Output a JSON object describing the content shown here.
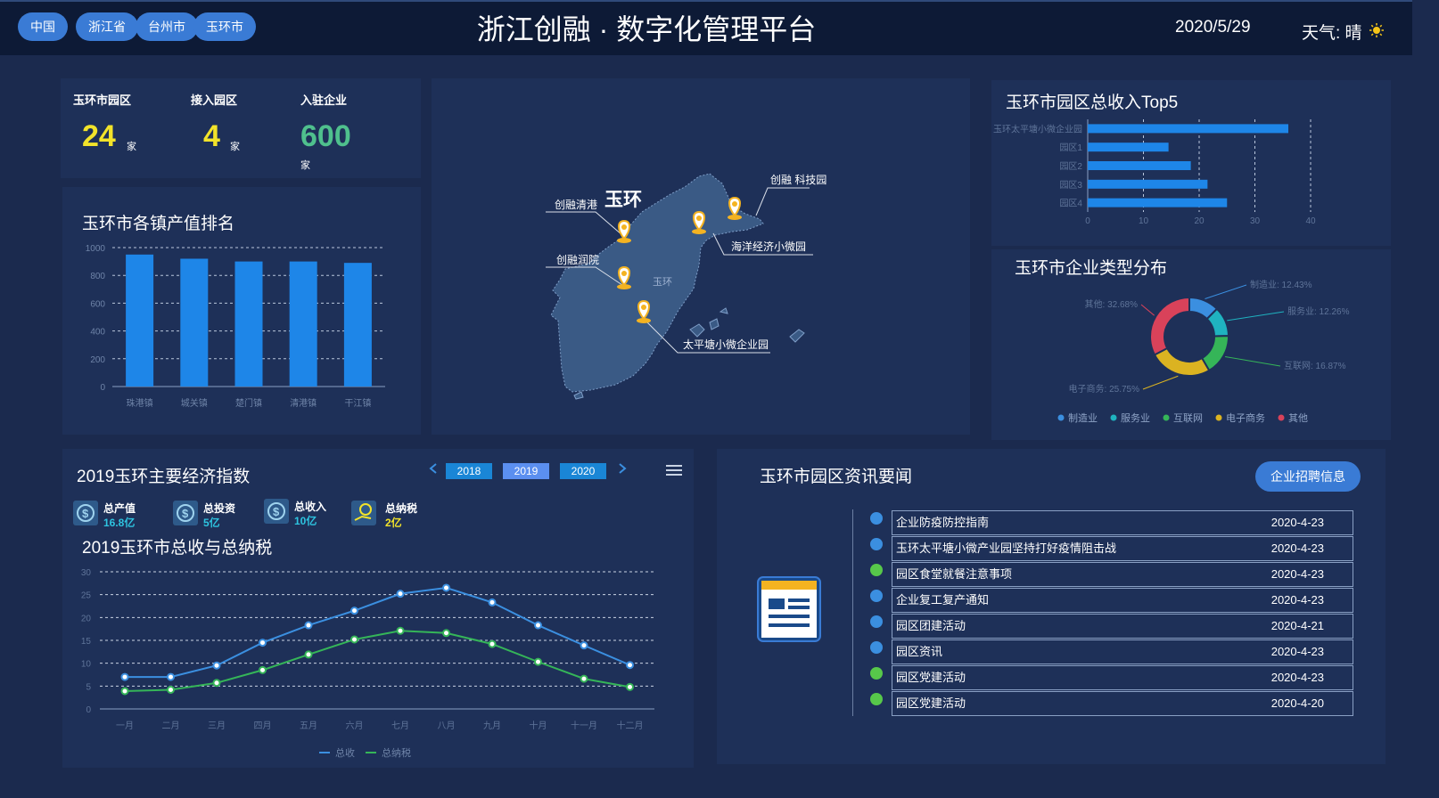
{
  "header": {
    "breadcrumbs": [
      "中国",
      "浙江省",
      "台州市",
      "玉环市"
    ],
    "title": "浙江创融 · 数字化管理平台",
    "date": "2020/5/29",
    "weather": "天气: 晴",
    "weather_icon": "sun-icon"
  },
  "stats": [
    {
      "label": "玉环市园区",
      "value": "24",
      "unit": "家",
      "color": "#f2e32a"
    },
    {
      "label": "接入园区",
      "value": "4",
      "unit": "家",
      "color": "#f2e32a"
    },
    {
      "label": "入驻企业",
      "value": "600",
      "unit": "家",
      "color": "#4fc08d"
    }
  ],
  "town_chart": {
    "title": "玉环市各镇产值排名",
    "chart_data": {
      "type": "bar",
      "categories": [
        "珠港镇",
        "城关镇",
        "楚门镇",
        "清港镇",
        "干江镇"
      ],
      "values": [
        950,
        920,
        900,
        900,
        890
      ],
      "ylim": [
        0,
        1000
      ],
      "yticks": [
        "0",
        "200",
        "400",
        "600",
        "800",
        "1000"
      ],
      "bar_color": "#1e86e8"
    }
  },
  "map": {
    "region_label": "玉环",
    "places": [
      "创融清港",
      "创融 科技园",
      "海洋经济小微园",
      "创融润院",
      "太平塘小微企业园"
    ],
    "small_label": "玉环"
  },
  "top5_chart": {
    "title": "玉环市园区总收入Top5",
    "chart_data": {
      "type": "bar",
      "orientation": "horizontal",
      "categories": [
        "玉环太平塘小微企业园",
        "园区1",
        "园区2",
        "园区3",
        "园区4"
      ],
      "values": [
        36,
        14.5,
        18.5,
        21.5,
        25
      ],
      "xlim": [
        0,
        40
      ],
      "xticks": [
        "0",
        "10",
        "20",
        "30",
        "40"
      ],
      "bar_color": "#1e86e8"
    }
  },
  "type_chart": {
    "title": "玉环市企业类型分布",
    "chart_data": {
      "type": "pie",
      "style": "donut",
      "slices": [
        {
          "name": "制造业",
          "value": 12.43,
          "label": "制造业: 12.43%",
          "color": "#3b8fe0"
        },
        {
          "name": "服务业",
          "value": 12.26,
          "label": "服务业: 12.26%",
          "color": "#1fb3c0"
        },
        {
          "name": "互联网",
          "value": 16.87,
          "label": "互联网: 16.87%",
          "color": "#35b558"
        },
        {
          "name": "电子商务",
          "value": 25.75,
          "label": "电子商务: 25.75%",
          "color": "#dbb321"
        },
        {
          "name": "其他",
          "value": 32.68,
          "label": "其他: 32.68%",
          "color": "#d9425a"
        }
      ],
      "legend": [
        "制造业",
        "服务业",
        "互联网",
        "电子商务",
        "其他"
      ]
    }
  },
  "economy": {
    "title": "2019玉环主要经济指数",
    "years": [
      "2018",
      "2019",
      "2020"
    ],
    "active_year": "2019",
    "prev_icon": "chevron-left-icon",
    "next_icon": "chevron-right-icon",
    "menu_icon": "menu-icon",
    "kpis": [
      {
        "label": "总产值",
        "value": "16.8亿",
        "icon": "money-icon",
        "color": "#2ec4e0"
      },
      {
        "label": "总投资",
        "value": "5亿",
        "icon": "money-icon",
        "color": "#2ec4e0"
      },
      {
        "label": "总收入",
        "value": "10亿",
        "icon": "money-icon",
        "color": "#2ec4e0"
      },
      {
        "label": "总纳税",
        "value": "2亿",
        "icon": "hand-coin-icon",
        "color": "#f2e32a"
      }
    ],
    "line_title": "2019玉环市总收与总纳税",
    "chart_data": {
      "type": "line",
      "categories": [
        "一月",
        "二月",
        "三月",
        "四月",
        "五月",
        "六月",
        "七月",
        "八月",
        "九月",
        "十月",
        "十一月",
        "十二月"
      ],
      "series": [
        {
          "name": "总收",
          "values": [
            7,
            7,
            9.5,
            14.5,
            18.3,
            21.5,
            25.2,
            26.5,
            23.3,
            18.3,
            13.9,
            9.6
          ],
          "color": "#3b8fe0"
        },
        {
          "name": "总纳税",
          "values": [
            3.9,
            4.2,
            5.7,
            8.5,
            11.9,
            15.2,
            17.1,
            16.6,
            14.2,
            10.3,
            6.6,
            4.8
          ],
          "color": "#35b558"
        }
      ],
      "ylim": [
        0,
        30
      ],
      "yticks": [
        "0",
        "5",
        "10",
        "15",
        "20",
        "25",
        "30"
      ]
    }
  },
  "news": {
    "title": "玉环市园区资讯要闻",
    "recruit_label": "企业招聘信息",
    "doc_icon": "news-document-icon",
    "items": [
      {
        "title": "企业防疫防控指南",
        "date": "2020-4-23",
        "dot": "#3b8fe0"
      },
      {
        "title": "玉环太平塘小微产业园坚持打好疫情阻击战",
        "date": "2020-4-23",
        "dot": "#3b8fe0"
      },
      {
        "title": "园区食堂就餐注意事项",
        "date": "2020-4-23",
        "dot": "#57c84a"
      },
      {
        "title": "企业复工复产通知",
        "date": "2020-4-23",
        "dot": "#3b8fe0"
      },
      {
        "title": "园区团建活动",
        "date": "2020-4-21",
        "dot": "#3b8fe0"
      },
      {
        "title": "园区资讯",
        "date": "2020-4-23",
        "dot": "#3b8fe0"
      },
      {
        "title": "园区党建活动",
        "date": "2020-4-23",
        "dot": "#57c84a"
      },
      {
        "title": "园区党建活动",
        "date": "2020-4-20",
        "dot": "#57c84a"
      }
    ]
  }
}
